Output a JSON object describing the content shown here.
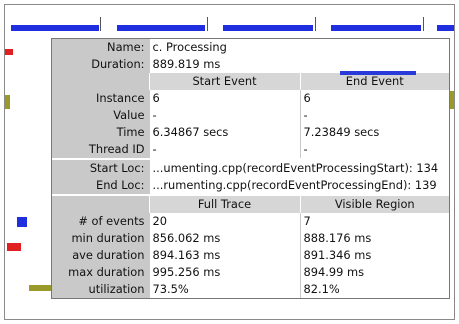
{
  "tooltip": {
    "name_label": "Name:",
    "name_value": "c. Processing",
    "duration_label": "Duration:",
    "duration_value": "889.819 ms",
    "events_table": {
      "headers": [
        "Start Event",
        "End Event"
      ],
      "rows": [
        {
          "label": "Instance",
          "start": "6",
          "end": "6"
        },
        {
          "label": "Value",
          "start": "-",
          "end": "-"
        },
        {
          "label": "Time",
          "start": "6.34867 secs",
          "end": "7.23849 secs"
        },
        {
          "label": "Thread ID",
          "start": "-",
          "end": "-"
        }
      ]
    },
    "location": {
      "start_label": "Start Loc:",
      "start_value": "...umenting.cpp(recordEventProcessingStart): 134",
      "end_label": "End Loc:",
      "end_value": "...rumenting.cpp(recordEventProcessingEnd): 139"
    },
    "stats_table": {
      "headers": [
        "Full Trace",
        "Visible Region"
      ],
      "rows": [
        {
          "label": "# of events",
          "full": "20",
          "visible": "7"
        },
        {
          "label": "min duration",
          "full": "856.062 ms",
          "visible": "888.176 ms"
        },
        {
          "label": "ave duration",
          "full": "894.163 ms",
          "visible": "891.346 ms"
        },
        {
          "label": "max duration",
          "full": "995.256 ms",
          "visible": "894.99 ms"
        },
        {
          "label": "utilization",
          "full": "73.5%",
          "visible": "82.1%"
        }
      ]
    }
  },
  "colors": {
    "blue": "#1f2fe0",
    "red": "#e02020",
    "pink": "#f4c4c8",
    "olive": "#9a9a2a",
    "header_gray": "#d6d6d6",
    "label_gray": "#c9c9c9"
  }
}
